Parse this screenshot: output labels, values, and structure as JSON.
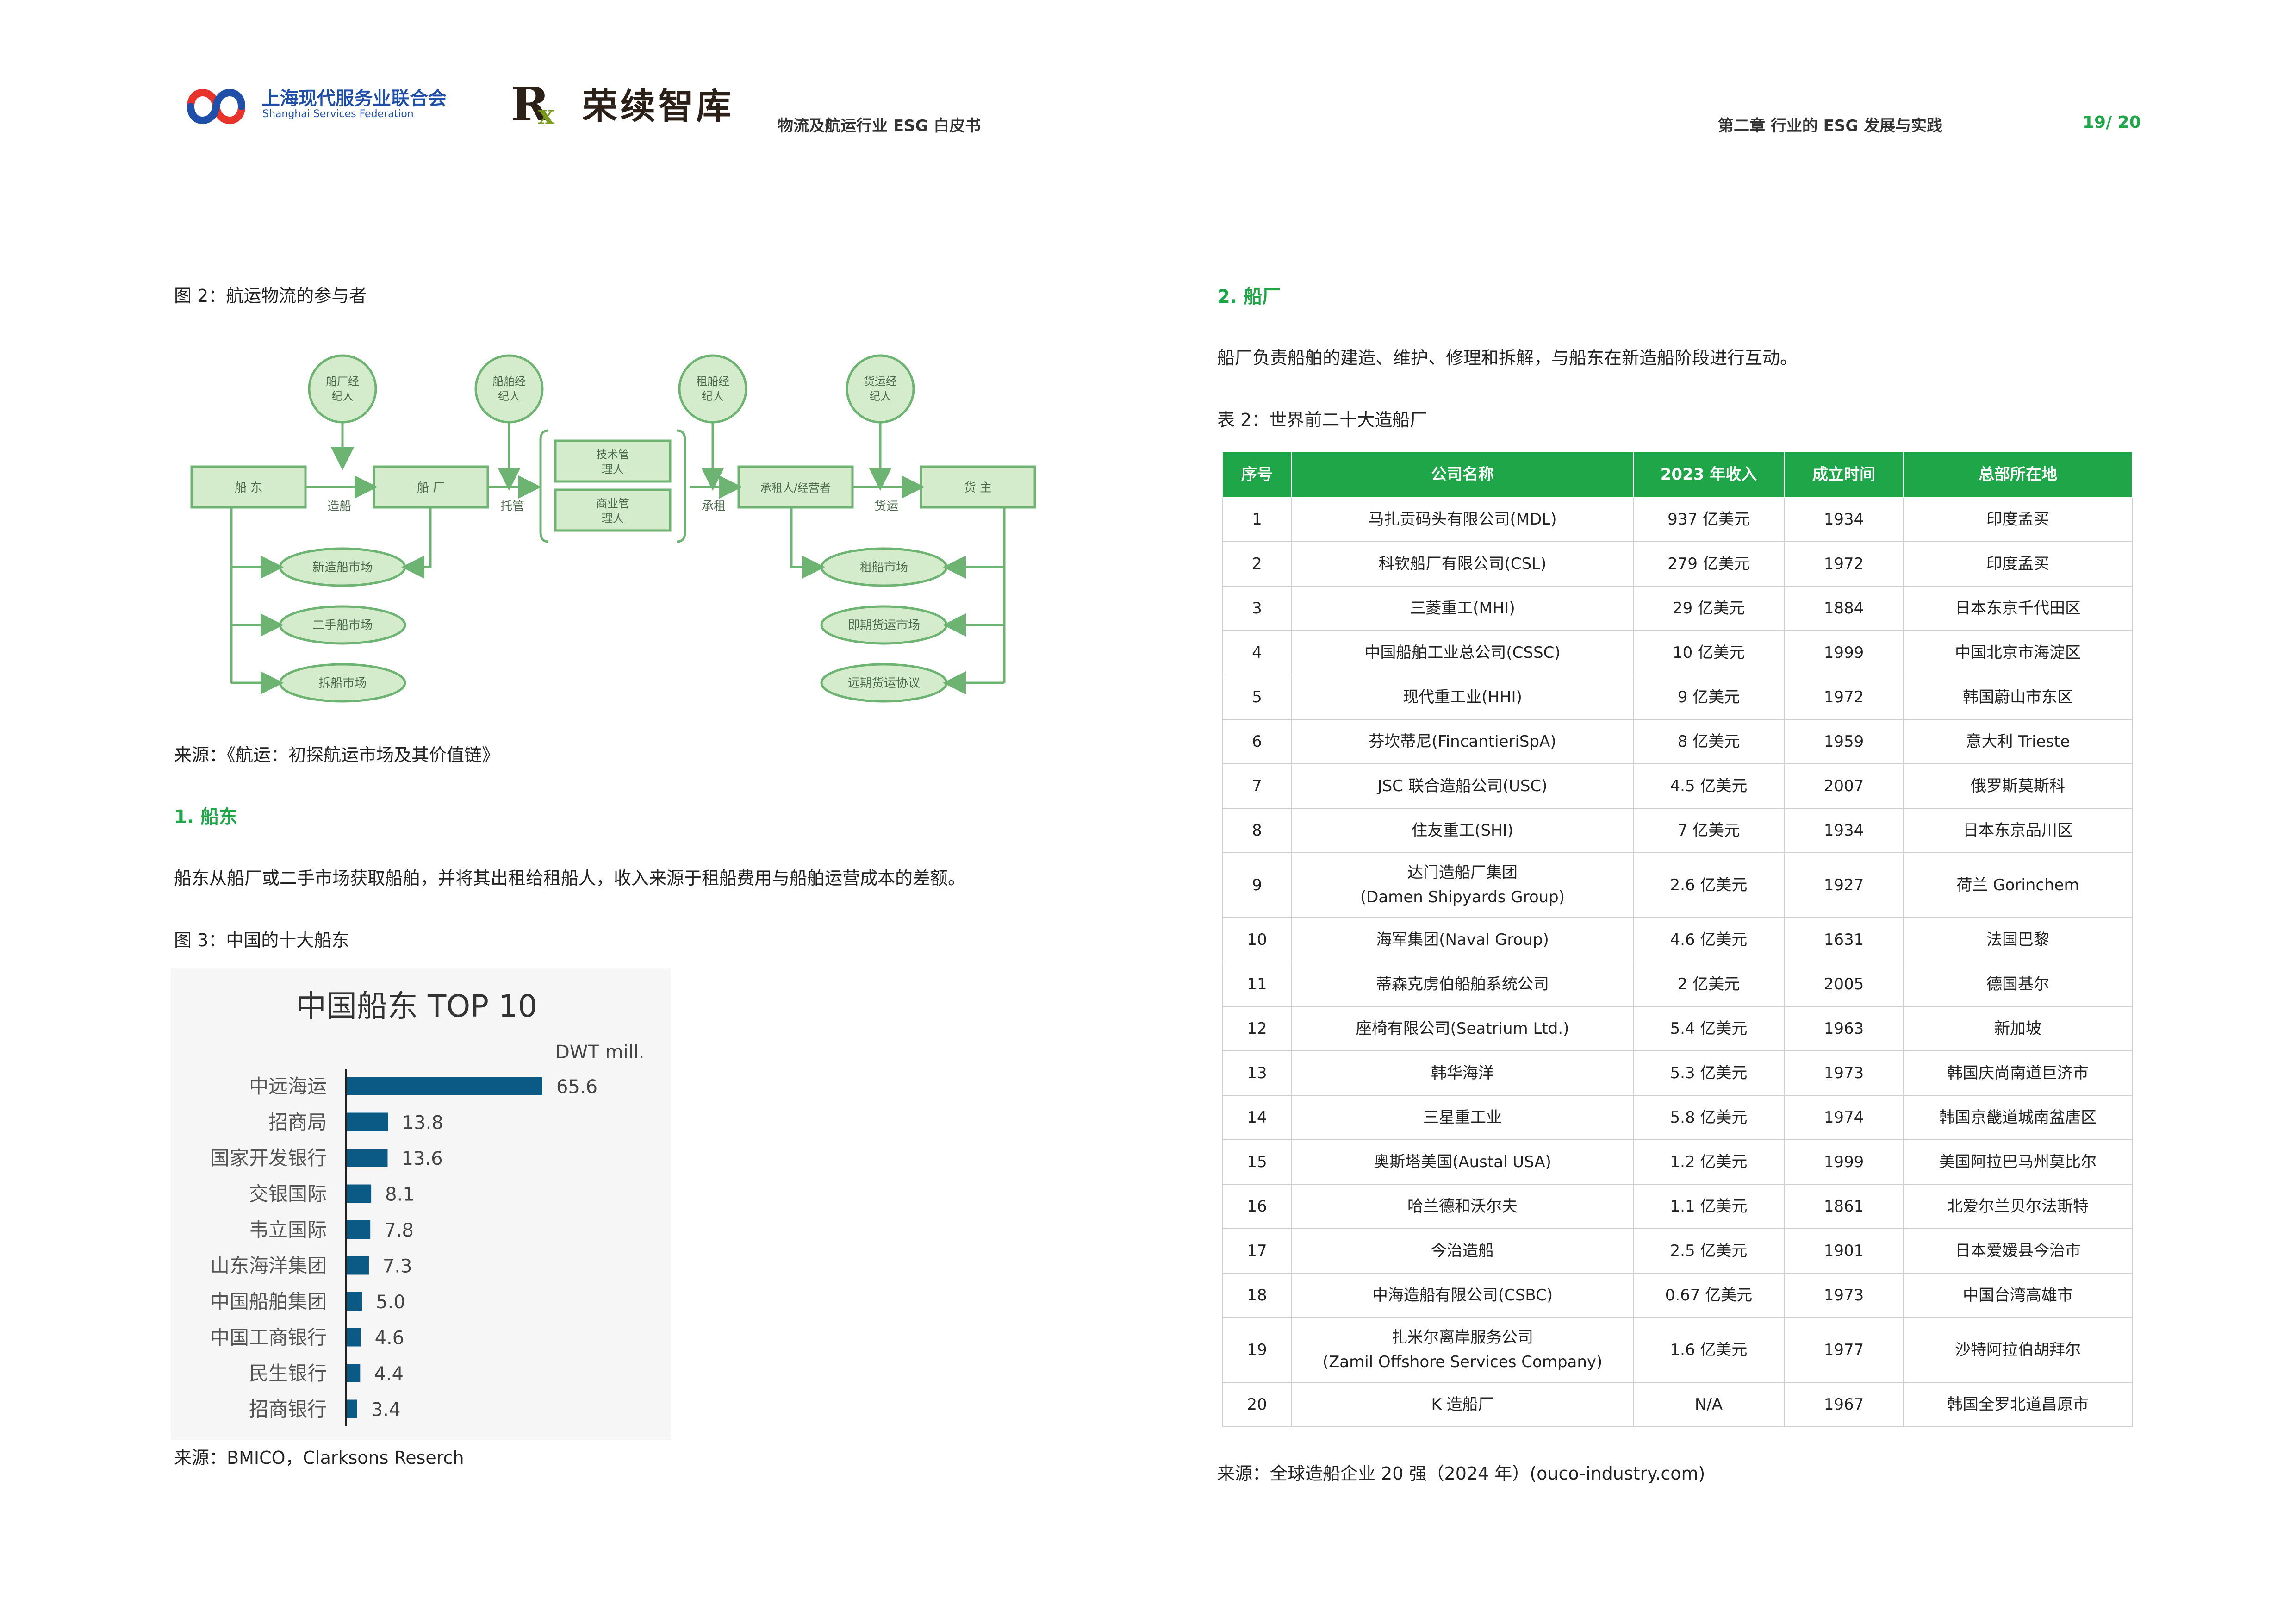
{
  "header": {
    "logo1_cn": "上海现代服务业联合会",
    "logo1_en": "Shanghai Services Federation",
    "logo2_cn": "荣续智库",
    "doc_title": "物流及航运行业 ESG 白皮书",
    "chapter": "第二章  行业的 ESG 发展与实践",
    "page": "19/ 20"
  },
  "left": {
    "fig2_caption": "图 2：航运物流的参与者",
    "fig2_source": "来源：《航运：初探航运市场及其价值链》",
    "section1_heading": "1.    船东",
    "section1_body": "船东从船厂或二手市场获取船舶，并将其出租给租船人，收入来源于租船费用与船舶运营成本的差额。",
    "fig3_caption": "图 3：中国的十大船东",
    "fig3_source": "来源：BMICO，Clarksons Reserch"
  },
  "diagram": {
    "brokers": [
      "船厂经纪人",
      "船舶经纪人",
      "租船经纪人",
      "货运经纪人"
    ],
    "main_boxes": [
      "船 东",
      "船 厂",
      "技术管理人",
      "商业管理人",
      "承租人/经营者",
      "货 主"
    ],
    "flow_labels": [
      "造船",
      "托管",
      "承租",
      "货运"
    ],
    "markets_left": [
      "新造船市场",
      "二手船市场",
      "拆船市场"
    ],
    "markets_right": [
      "租船市场",
      "即期货运市场",
      "远期货运协议"
    ]
  },
  "chart_data": {
    "type": "bar",
    "orientation": "horizontal",
    "title": "中国船东 TOP 10",
    "unit_label": "DWT mill.",
    "categories": [
      "中远海运",
      "招商局",
      "国家开发银行",
      "交银国际",
      "韦立国际",
      "山东海洋集团",
      "中国船舶集团",
      "中国工商银行",
      "民生银行",
      "招商银行"
    ],
    "values": [
      65.6,
      13.8,
      13.6,
      8.1,
      7.8,
      7.3,
      5.0,
      4.6,
      4.4,
      3.4
    ],
    "value_labels": [
      "65.6",
      "13.8",
      "13.6",
      "8.1",
      "7.8",
      "7.3",
      "5.0",
      "4.6",
      "4.4",
      "3.4"
    ],
    "xlim": [
      0,
      65.6
    ],
    "bar_color": "#0b5a86",
    "grid": false
  },
  "right": {
    "section2_heading": "2.    船厂",
    "section2_body": "船厂负责船舶的建造、维护、修理和拆解，与船东在新造船阶段进行互动。",
    "table_caption": "表 2：世界前二十大造船厂",
    "table_source": "来源：全球造船企业 20 强（2024 年）(ouco-industry.com)"
  },
  "table": {
    "headers": [
      "序号",
      "公司名称",
      "2023 年收入",
      "成立时间",
      "总部所在地"
    ],
    "rows": [
      [
        "1",
        "马扎贡码头有限公司(MDL)",
        "937 亿美元",
        "1934",
        "印度孟买"
      ],
      [
        "2",
        "科钦船厂有限公司(CSL)",
        "279 亿美元",
        "1972",
        "印度孟买"
      ],
      [
        "3",
        "三菱重工(MHI)",
        "29 亿美元",
        "1884",
        "日本东京千代田区"
      ],
      [
        "4",
        "中国船舶工业总公司(CSSC)",
        "10 亿美元",
        "1999",
        "中国北京市海淀区"
      ],
      [
        "5",
        "现代重工业(HHI)",
        "9 亿美元",
        "1972",
        "韩国蔚山市东区"
      ],
      [
        "6",
        "芬坎蒂尼(FincantieriSpA)",
        "8 亿美元",
        "1959",
        "意大利 Trieste"
      ],
      [
        "7",
        "JSC 联合造船公司(USC)",
        "4.5 亿美元",
        "2007",
        "俄罗斯莫斯科"
      ],
      [
        "8",
        "住友重工(SHI)",
        "7 亿美元",
        "1934",
        "日本东京品川区"
      ],
      [
        "9",
        "达门造船厂集团\n(Damen Shipyards Group)",
        "2.6 亿美元",
        "1927",
        "荷兰 Gorinchem"
      ],
      [
        "10",
        "海军集团(Naval Group)",
        "4.6 亿美元",
        "1631",
        "法国巴黎"
      ],
      [
        "11",
        "蒂森克虏伯船舶系统公司",
        "2 亿美元",
        "2005",
        "德国基尔"
      ],
      [
        "12",
        "座椅有限公司(Seatrium Ltd.)",
        "5.4 亿美元",
        "1963",
        "新加坡"
      ],
      [
        "13",
        "韩华海洋",
        "5.3 亿美元",
        "1973",
        "韩国庆尚南道巨济市"
      ],
      [
        "14",
        "三星重工业",
        "5.8 亿美元",
        "1974",
        "韩国京畿道城南盆唐区"
      ],
      [
        "15",
        "奥斯塔美国(Austal USA)",
        "1.2 亿美元",
        "1999",
        "美国阿拉巴马州莫比尔"
      ],
      [
        "16",
        "哈兰德和沃尔夫",
        "1.1 亿美元",
        "1861",
        "北爱尔兰贝尔法斯特"
      ],
      [
        "17",
        "今治造船",
        "2.5 亿美元",
        "1901",
        "日本爱媛县今治市"
      ],
      [
        "18",
        "中海造船有限公司(CSBC)",
        "0.67 亿美元",
        "1973",
        "中国台湾高雄市"
      ],
      [
        "19",
        "扎米尔离岸服务公司\n(Zamil Offshore Services Company)",
        "1.6 亿美元",
        "1977",
        "沙特阿拉伯胡拜尔"
      ],
      [
        "20",
        "K 造船厂",
        "N/A",
        "1967",
        "韩国全罗北道昌原市"
      ]
    ]
  },
  "colors": {
    "accent_green": "#1ea649",
    "logo_blue": "#1f4fa8",
    "logo_red": "#e8332a",
    "diagram_green_fill": "#d4eccb",
    "diagram_green_stroke": "#6db472",
    "bar_blue": "#0b5a86"
  }
}
